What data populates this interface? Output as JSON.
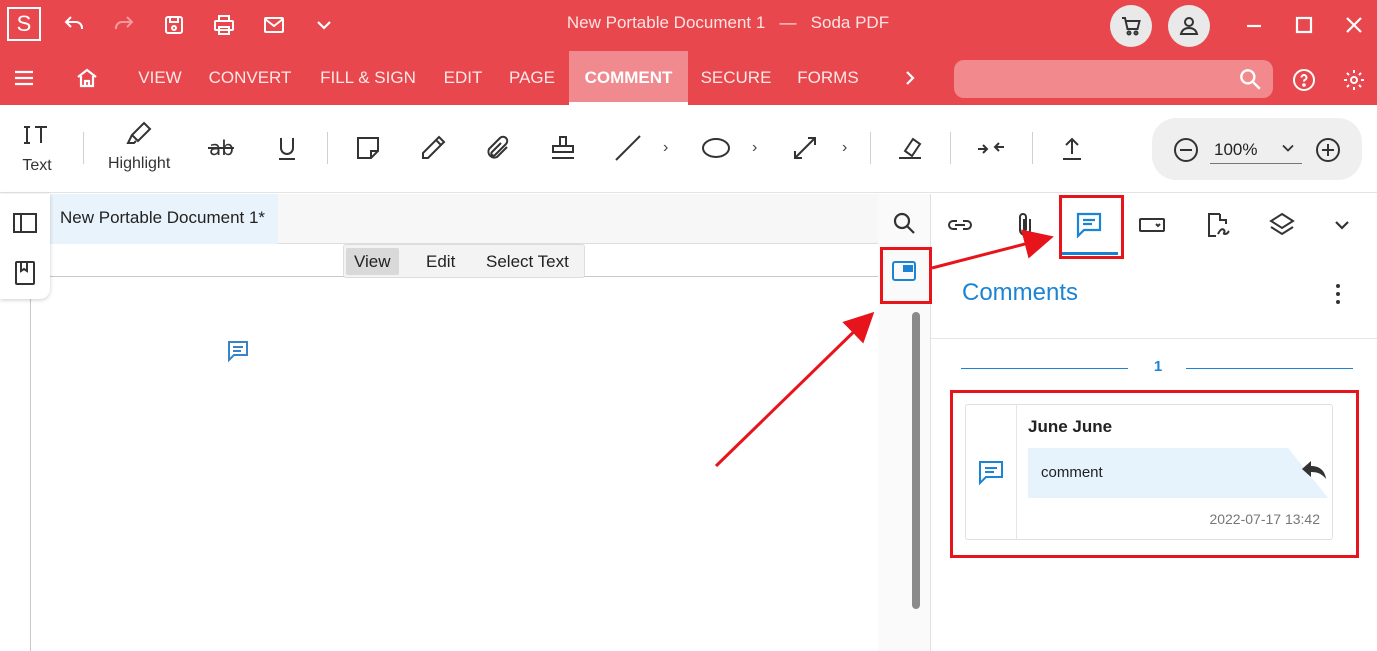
{
  "app": {
    "logo": "S",
    "title": "New Portable Document 1",
    "title_sep": "—",
    "app_name": "Soda PDF"
  },
  "nav": {
    "items": [
      "VIEW",
      "CONVERT",
      "FILL & SIGN",
      "EDIT",
      "PAGE",
      "COMMENT",
      "SECURE",
      "FORMS"
    ],
    "active": "COMMENT",
    "search_placeholder": ""
  },
  "ribbon": {
    "text_label": "Text",
    "highlight_label": "Highlight",
    "zoom": "100%"
  },
  "document": {
    "tab": "New Portable Document 1*",
    "modes": [
      "View",
      "Edit",
      "Select Text"
    ],
    "active_mode": "View"
  },
  "panel": {
    "title": "Comments",
    "page_number": "1",
    "comment": {
      "author": "June June",
      "text": "comment",
      "timestamp": "2022-07-17 13:42"
    }
  },
  "colors": {
    "brand": "#e8474d",
    "accent": "#1c84d4",
    "annotation": "#e8141c"
  },
  "icons": {
    "toolbar": [
      "undo-icon",
      "redo-icon",
      "save-icon",
      "print-icon",
      "mail-icon",
      "chevron-down-icon"
    ],
    "panel_tabs": [
      "link-icon",
      "attachment-icon",
      "comments-icon",
      "form-field-icon",
      "signature-icon",
      "layers-icon",
      "chevron-down-icon"
    ]
  }
}
